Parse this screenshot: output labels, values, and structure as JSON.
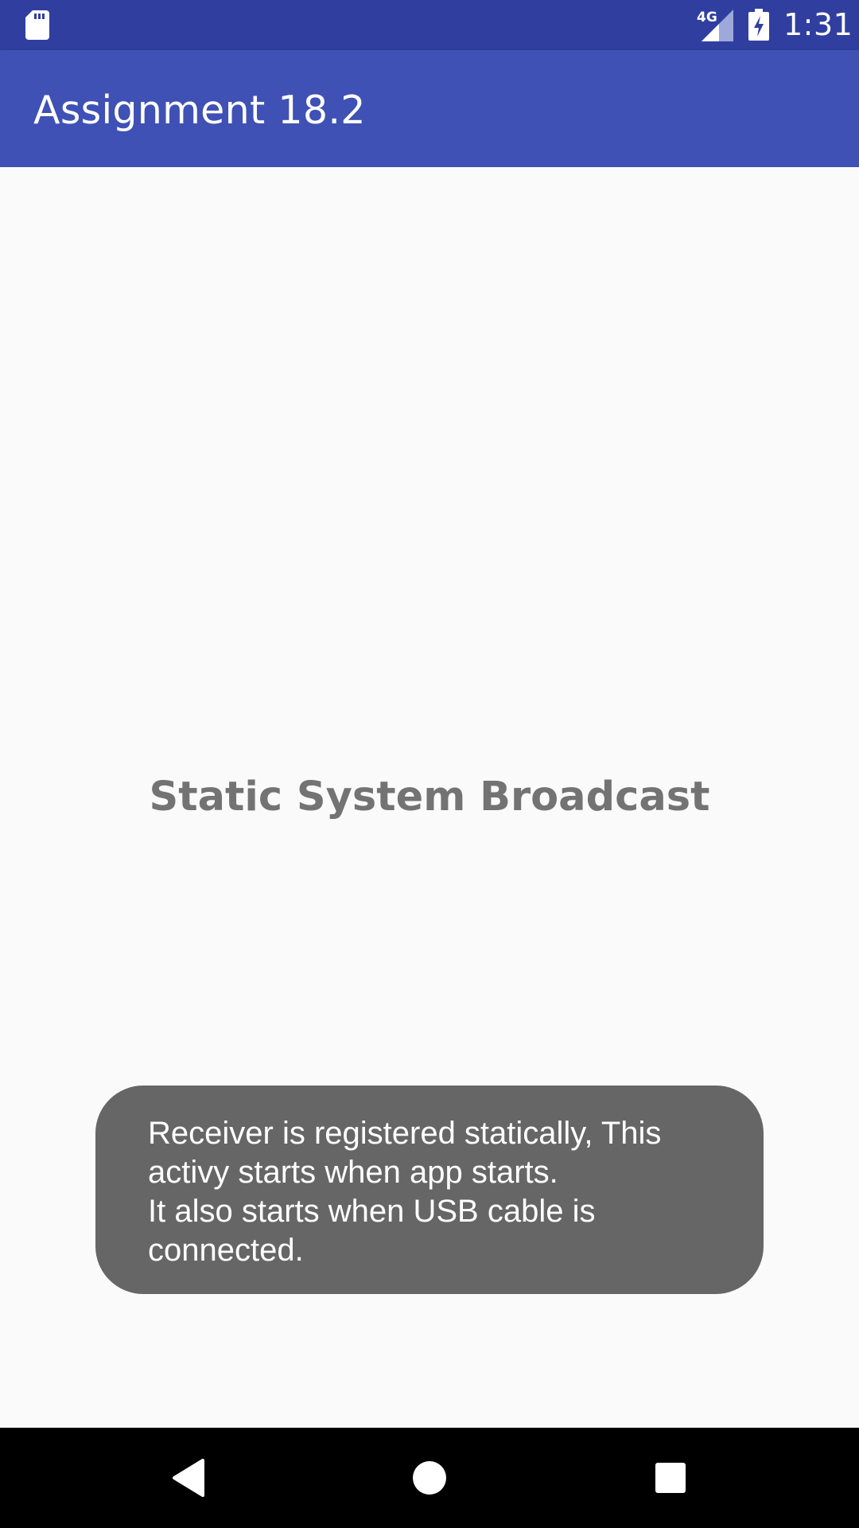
{
  "status_bar": {
    "network_label": "4G",
    "time": "1:31",
    "icons": [
      "sd-card-icon",
      "signal-icon",
      "battery-charging-icon"
    ]
  },
  "app_bar": {
    "title": "Assignment 18.2"
  },
  "main": {
    "heading": "Static System Broadcast"
  },
  "toast": {
    "message": "Receiver is registered statically, This\nactivy starts when app starts.\nIt also starts when USB cable is\nconnected."
  },
  "nav_bar": {
    "buttons": [
      "back-icon",
      "home-icon",
      "recents-icon"
    ]
  },
  "colors": {
    "status_bar": "#303f9f",
    "app_bar": "#3f51b5",
    "background": "#fafafa",
    "toast": "#666666",
    "heading_text": "#737373"
  }
}
